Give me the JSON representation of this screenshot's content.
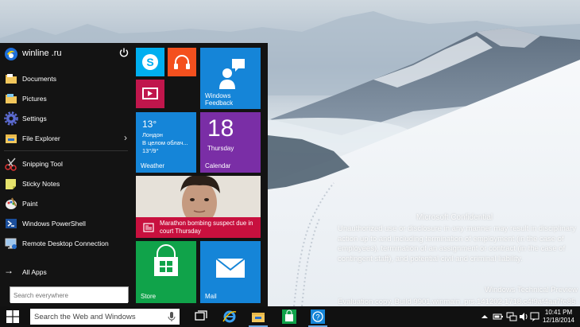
{
  "desktop": {
    "watermark": {
      "title": "Microsoft Confidential",
      "body": "Unauthorized use or disclosure in any manner may result in disciplinary action up to and including termination of employment (in the case of employees), termination of an assignment or contract (in the case of contingent staff), and potential civil and criminal liability.",
      "preview": "Windows Technical Preview",
      "build": "Evaluation copy. Build 9901.winmain_prs.141202-1718.c4f9af4aa7fe8544"
    }
  },
  "start_menu": {
    "user_name": "winline .ru",
    "items": [
      {
        "label": "Documents",
        "icon": "documents-folder-icon"
      },
      {
        "label": "Pictures",
        "icon": "pictures-folder-icon"
      },
      {
        "label": "Settings",
        "icon": "gear-icon"
      },
      {
        "label": "File Explorer",
        "icon": "file-explorer-icon",
        "has_arrow": true
      },
      {
        "label": "Snipping Tool",
        "icon": "scissors-icon"
      },
      {
        "label": "Sticky Notes",
        "icon": "sticky-notes-icon"
      },
      {
        "label": "Paint",
        "icon": "paint-icon"
      },
      {
        "label": "Windows PowerShell",
        "icon": "powershell-icon"
      },
      {
        "label": "Remote Desktop Connection",
        "icon": "remote-desktop-icon"
      }
    ],
    "all_apps": "All Apps",
    "search_placeholder": "Search everywhere",
    "tiles": {
      "feedback": "Windows Feedback",
      "weather": {
        "temp": "13°",
        "city": "Лондон",
        "condition": "В целом облач...",
        "range": "13°/9°",
        "label": "Weather"
      },
      "calendar": {
        "day": "18",
        "weekday": "Thursday",
        "label": "Calendar"
      },
      "news": {
        "headline": "Marathon bombing suspect due in court Thursday"
      },
      "store": "Store",
      "mail": "Mail"
    }
  },
  "taskbar": {
    "search_placeholder": "Search the Web and Windows",
    "time": "10:41 PM",
    "date": "12/18/2014"
  },
  "colors": {
    "tile_blue": "#1585d8",
    "tile_purple": "#7a2ea6",
    "tile_green": "#10a34a",
    "tile_orange": "#f4501e",
    "tile_red": "#c0164c",
    "skype_blue": "#00aff0",
    "news_red": "#c8103e"
  }
}
